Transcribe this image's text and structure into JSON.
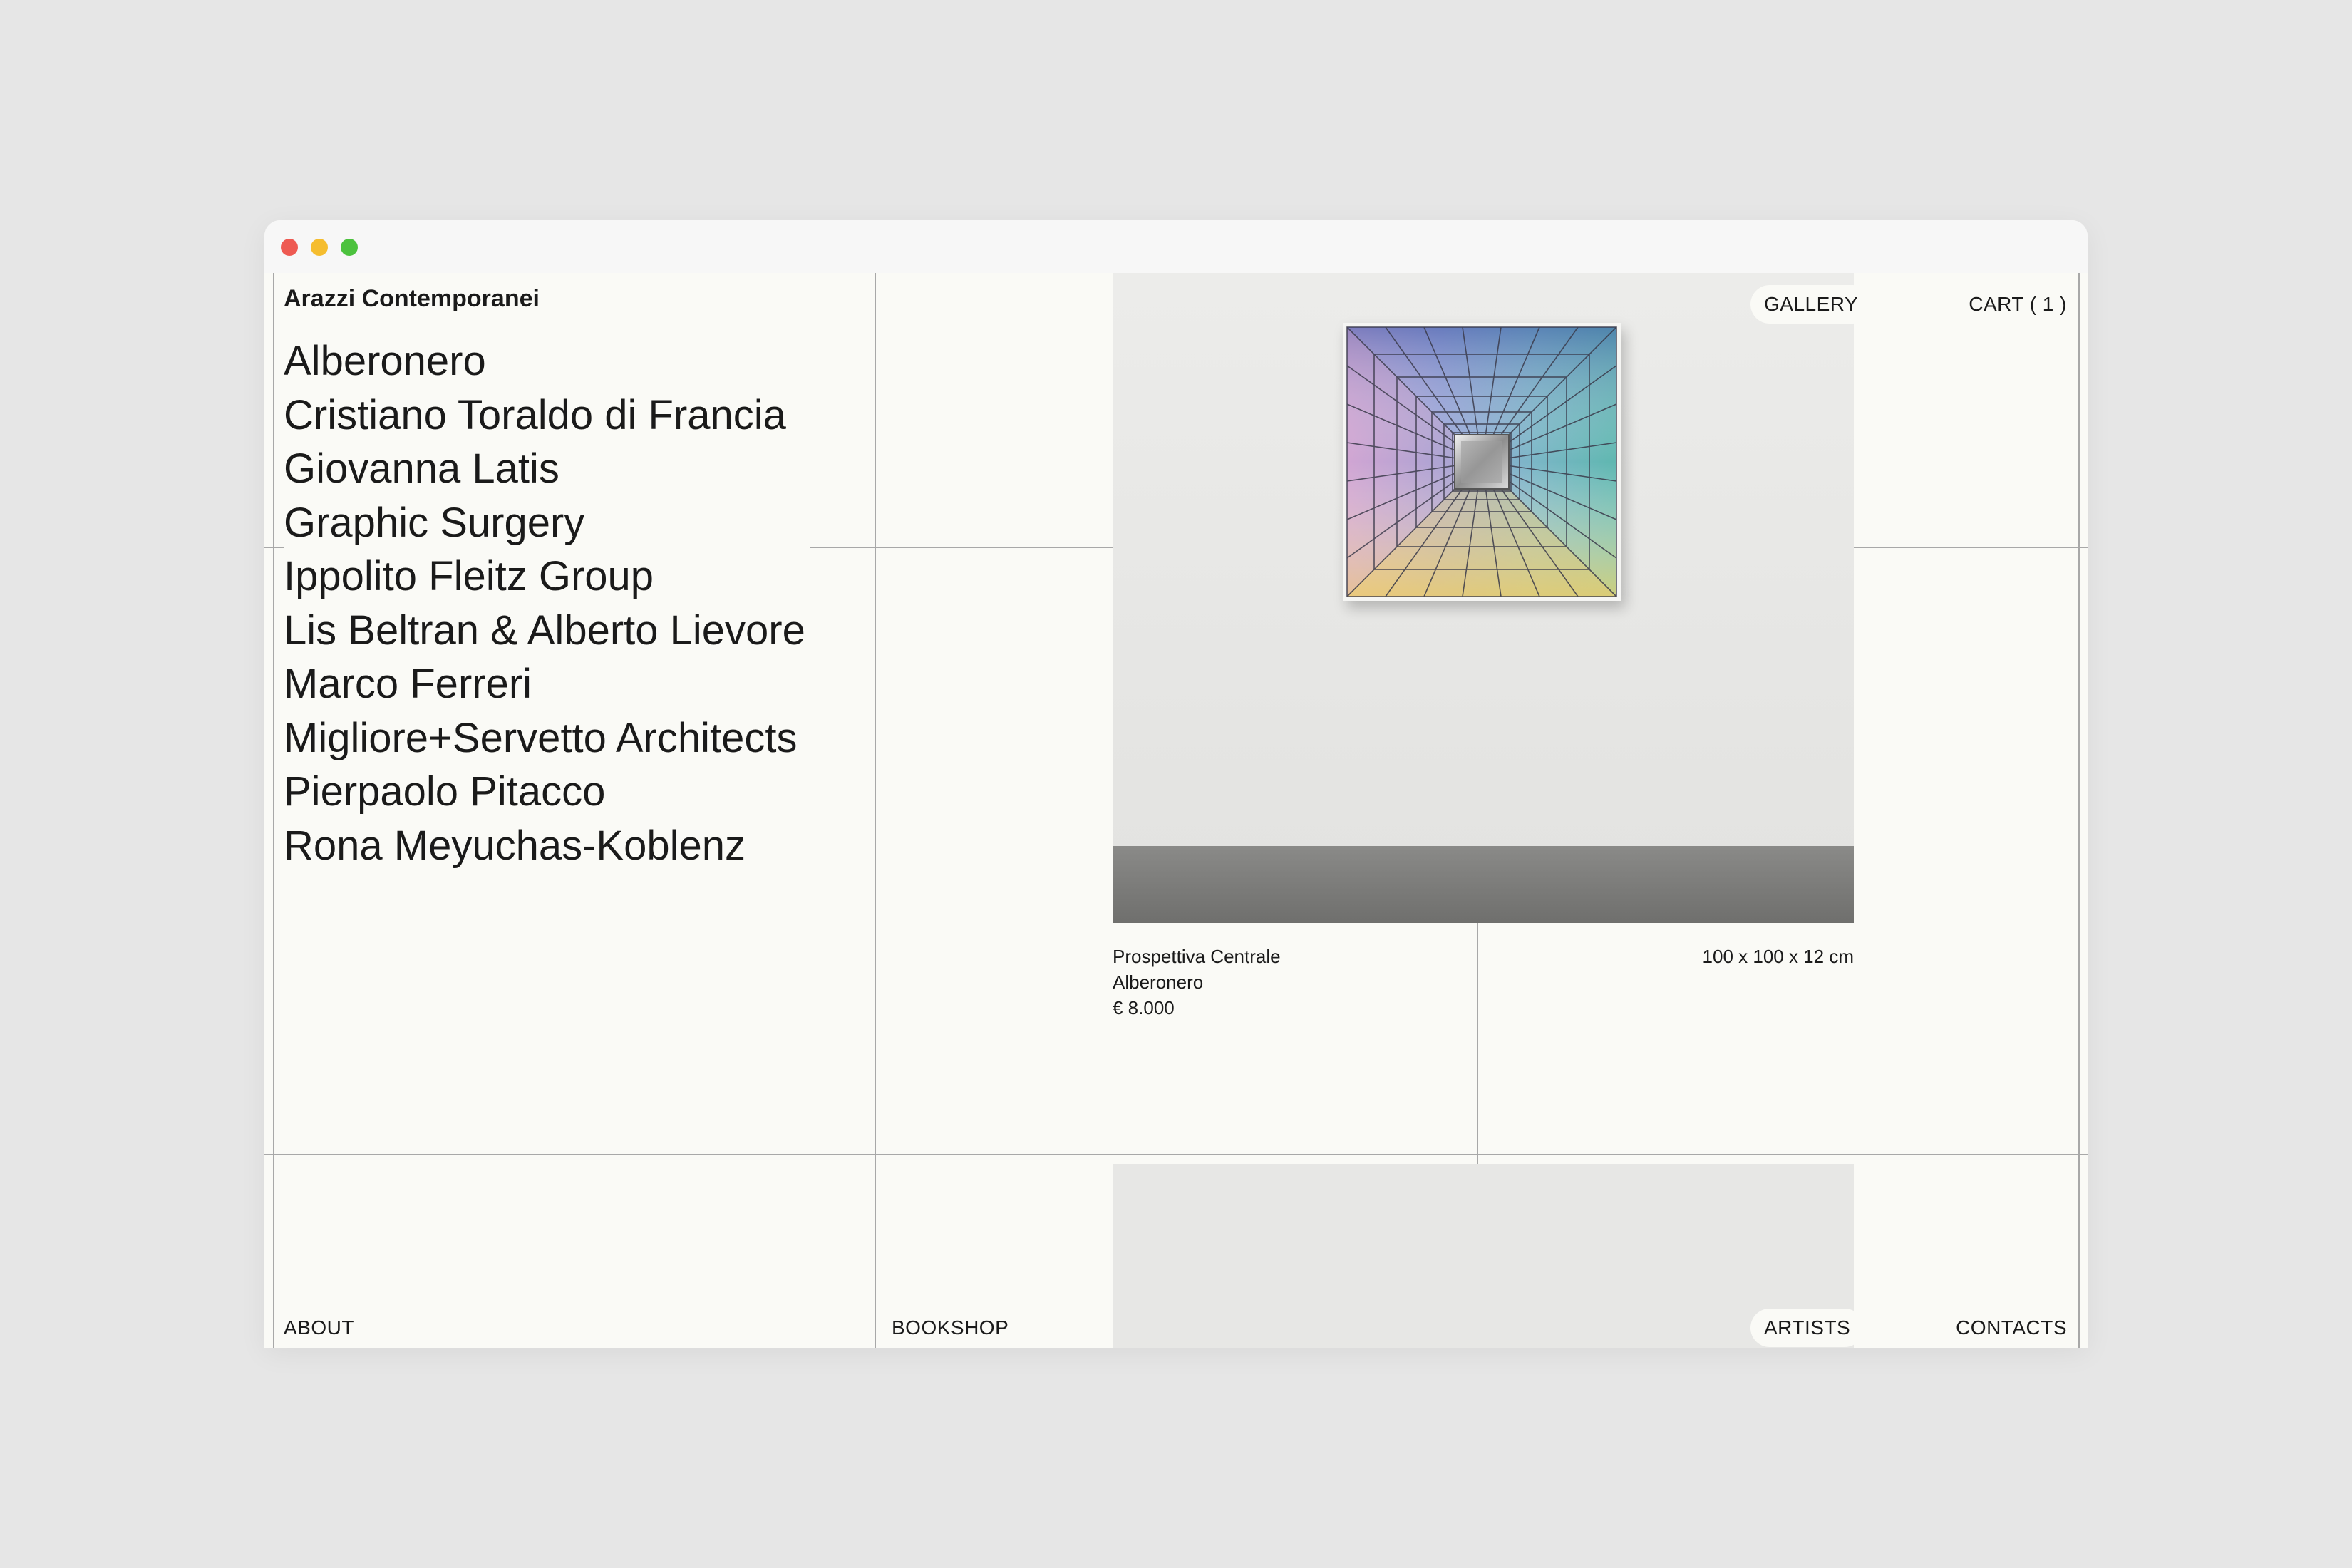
{
  "site": {
    "title": "Arazzi Contemporanei"
  },
  "artists": [
    "Alberonero",
    "Cristiano Toraldo di Francia",
    "Giovanna Latis",
    "Graphic Surgery",
    "Ippolito Fleitz Group",
    "Lis Beltran & Alberto Lievore",
    "Marco Ferreri",
    "Migliore+Servetto Architects",
    "Pierpaolo Pitacco",
    "Rona Meyuchas-Koblenz"
  ],
  "nav": {
    "gallery": "GALLERY",
    "cart": "CART ( 1 )",
    "about": "ABOUT",
    "bookshop": "BOOKSHOP",
    "artists": "ARTISTS",
    "contacts": "CONTACTS"
  },
  "product": {
    "title": "Prospettiva Centrale",
    "artist": "Alberonero",
    "price": "€ 8.000",
    "dimensions": "100 x 100 x 12 cm"
  },
  "colors": {
    "background": "#fafaf6",
    "grid_line": "#a8a8a8",
    "outer": "#e6e6e6"
  },
  "icons": {
    "close": "red-window-dot",
    "minimize": "yellow-window-dot",
    "zoom": "green-window-dot"
  }
}
